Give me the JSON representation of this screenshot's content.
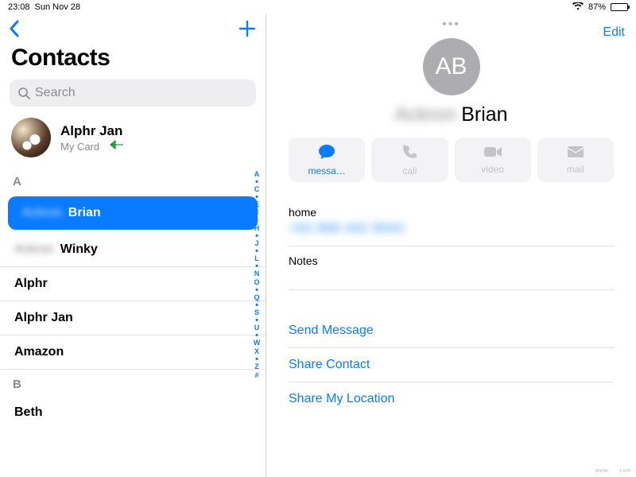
{
  "status": {
    "time": "23:08",
    "date": "Sun Nov 28",
    "battery_pct": "87%"
  },
  "sidebar": {
    "back_icon": "chevron-left",
    "add_icon": "plus",
    "title": "Contacts",
    "search_placeholder": "Search",
    "my_card": {
      "name": "Alphr Jan",
      "subtitle": "My Card"
    },
    "sections": [
      {
        "letter": "A",
        "rows": [
          {
            "first_blurred": "Ackron",
            "last": "Brian",
            "selected": true
          },
          {
            "first_blurred": "Ackron",
            "last": "Winky",
            "selected": false
          },
          {
            "first_blurred": "",
            "last": "Alphr",
            "selected": false
          },
          {
            "first_blurred": "",
            "last": "Alphr Jan",
            "selected": false
          },
          {
            "first_blurred": "",
            "last": "Amazon",
            "selected": false
          }
        ]
      },
      {
        "letter": "B",
        "rows": [
          {
            "first_blurred": "",
            "last": "Beth",
            "selected": false
          }
        ]
      }
    ],
    "index": [
      "A",
      "•",
      "C",
      "•",
      "E",
      "F",
      "•",
      "H",
      "•",
      "J",
      "•",
      "L",
      "•",
      "N",
      "O",
      "•",
      "Q",
      "•",
      "S",
      "•",
      "U",
      "•",
      "W",
      "X",
      "•",
      "Z",
      "#"
    ]
  },
  "detail": {
    "edit_label": "Edit",
    "avatar_initials": "AB",
    "name_first_blurred": "Ackron",
    "name_last": "Brian",
    "actions": {
      "message": "messa…",
      "call": "call",
      "video": "video",
      "mail": "mail"
    },
    "phone_label": "home",
    "phone_value_blurred": "+63 968 432 9543",
    "notes_label": "Notes",
    "links": {
      "send_message": "Send Message",
      "share_contact": "Share Contact",
      "share_location": "Share My Location"
    }
  },
  "colors": {
    "accent": "#0a7aff"
  }
}
